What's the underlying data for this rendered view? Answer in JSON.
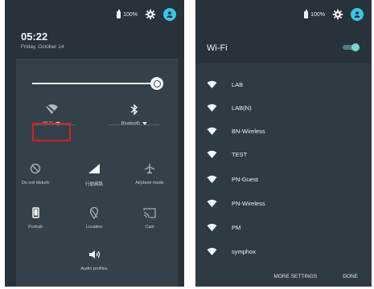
{
  "left": {
    "status": {
      "battery": "100%",
      "icons": [
        "battery-icon",
        "settings-gear-icon",
        "account-circle-icon"
      ]
    },
    "time": "05:22",
    "date": "Friday, October 14",
    "tiles": [
      {
        "label": "Wi-Fi",
        "icon": "wifi-icon",
        "interactable": true
      },
      {
        "label": "Bluetooth",
        "icon": "bluetooth-icon",
        "interactable": true
      },
      {
        "label": "Do not disturb",
        "icon": "do-not-disturb-icon"
      },
      {
        "label": "行動網路",
        "icon": "cellular-signal-icon"
      },
      {
        "label": "Airplane mode",
        "icon": "airplane-icon"
      },
      {
        "label": "Portrait",
        "icon": "portrait-icon"
      },
      {
        "label": "Location",
        "icon": "location-icon"
      },
      {
        "label": "Cast",
        "icon": "cast-icon"
      },
      {
        "label": "Audio profiles",
        "icon": "audio-profiles-icon"
      }
    ]
  },
  "right": {
    "status": {
      "battery": "100%"
    },
    "title": "Wi-Fi",
    "toggle_state": "on",
    "networks": [
      "LAB",
      "LAB(N)",
      "BN-Wireless",
      "TEST",
      "PN-Guest",
      "PN-Wireless",
      "PM",
      "symphox"
    ],
    "buttons": {
      "more_settings": "MORE SETTINGS",
      "done": "DONE"
    }
  }
}
